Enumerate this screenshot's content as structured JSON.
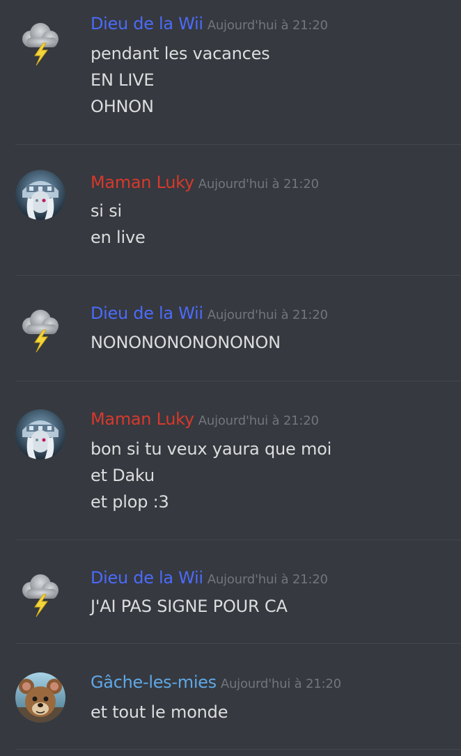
{
  "colors": {
    "background": "#36393f",
    "text": "#dcddde",
    "timestamp": "#72767d",
    "dieu": "#4b6bfb",
    "maman": "#d8392c",
    "gache": "#5fa8e8"
  },
  "messages": [
    {
      "author": "Dieu de la Wii",
      "author_color": "#4b6bfb",
      "avatar_icon": "storm-cloud-icon",
      "timestamp": "Aujourd'hui à 21:20",
      "lines": [
        "pendant les vacances",
        "EN LIVE",
        "OHNON"
      ]
    },
    {
      "author": "Maman Luky",
      "author_color": "#d8392c",
      "avatar_icon": "character-avatar",
      "timestamp": "Aujourd'hui à 21:20",
      "lines": [
        "si si",
        "en live"
      ]
    },
    {
      "author": "Dieu de la Wii",
      "author_color": "#4b6bfb",
      "avatar_icon": "storm-cloud-icon",
      "timestamp": "Aujourd'hui à 21:20",
      "lines": [
        "NONONONONONONON"
      ]
    },
    {
      "author": "Maman Luky",
      "author_color": "#d8392c",
      "avatar_icon": "character-avatar",
      "timestamp": "Aujourd'hui à 21:20",
      "lines": [
        "bon si tu veux yaura que moi",
        "et Daku",
        "et plop :3"
      ]
    },
    {
      "author": "Dieu de la Wii",
      "author_color": "#4b6bfb",
      "avatar_icon": "storm-cloud-icon",
      "timestamp": "Aujourd'hui à 21:20",
      "lines": [
        "J'AI PAS SIGNE POUR CA"
      ]
    },
    {
      "author": "Gâche-les-mies",
      "author_color": "#5fa8e8",
      "avatar_icon": "mouse-avatar",
      "timestamp": "Aujourd'hui à 21:20",
      "lines": [
        "et tout le monde"
      ]
    }
  ]
}
